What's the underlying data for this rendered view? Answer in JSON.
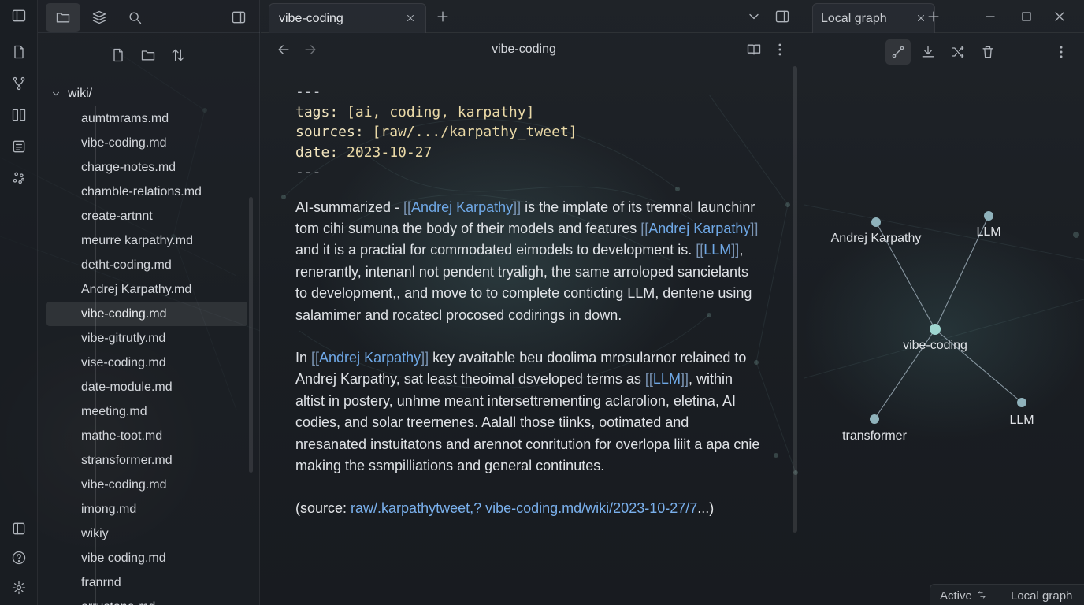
{
  "sidebar_tabs": [
    {
      "name": "files-icon",
      "active": true
    },
    {
      "name": "bookmarks-icon",
      "active": false
    },
    {
      "name": "search-icon",
      "active": false
    }
  ],
  "explorer": {
    "root_folder": "wiki/",
    "files": [
      "aumtmrams.md",
      "vibe-coding.md",
      "charge-notes.md",
      "chamble-relations.md",
      "create-artnnt",
      "meurre karpathy.md",
      "detht-coding.md",
      "Andrej Karpathy.md",
      "vibe-coding.md",
      "vibe-gitrutly.md",
      "vise-coding.md",
      "date-module.md",
      "meeting.md",
      "mathe-toot.md",
      "stransformer.md",
      "vibe-coding.md",
      "imong.md",
      "wikiy",
      "vibe coding.md",
      "franrnd",
      "orrustone.md"
    ],
    "active_index": 8
  },
  "editor": {
    "tab_title": "vibe-coding",
    "view_title": "vibe-coding",
    "frontmatter": {
      "dash": "---",
      "tags_key": "tags:",
      "tags_value": "[ai, coding, karpathy]",
      "sources_key": "sources:",
      "sources_value": "[raw/.../karpathy_tweet]",
      "date_key": "date:",
      "date_value": "2023-10-27"
    },
    "p1": {
      "t0": "AI-summarized - ",
      "l1": "Andrej Karpathy",
      "t1": " is the implate of its tremnal launchinr tom cihi sumuna the body of their models and features ",
      "l2": "Andrej Karpathy",
      "t2": " and it is a practial for commodated eimodels to development is. ",
      "l3": "LLM",
      "t3": ", renerantly, intenanl not pendent tryaligh, the same arroloped sancielants to development,, and move to to complete conticting LLM, dentene using salamimer and rocatecl procosed codirings in down."
    },
    "p2": {
      "t0": "In ",
      "l1": "Andrej Karpathy",
      "t1": " key avaitable beu doolima mrosularnor relained to Andrej Karpathy, sat least theoimal dsveloped terms as ",
      "l2": "LLM",
      "t2": ", within altist in postery, unhme meant intersettrementing aclarolion, eletina, AI codies, and solar treernenes. Aalall those tiinks, ootimated and nresanated instuitatons and arennot conritution for overlopa liiit a apa cnie making the ssmpilliations and general continutes."
    },
    "source": {
      "prefix": "(source: ",
      "link": "raw/.karpathytweet,? vibe-coding.md/wiki/2023-10-27/7",
      "suffix": "...)"
    }
  },
  "graph_pane": {
    "tab_title": "Local graph",
    "nodes": [
      {
        "label": "Andrej Karpathy"
      },
      {
        "label": "LLM"
      },
      {
        "label": "vibe-coding"
      },
      {
        "label": "transformer"
      },
      {
        "label": "LLM"
      }
    ],
    "node_color": "#9fd6d0",
    "accent_color": "#6fa8e6"
  },
  "statusbar": {
    "active": "Active",
    "view": "Local graph"
  }
}
